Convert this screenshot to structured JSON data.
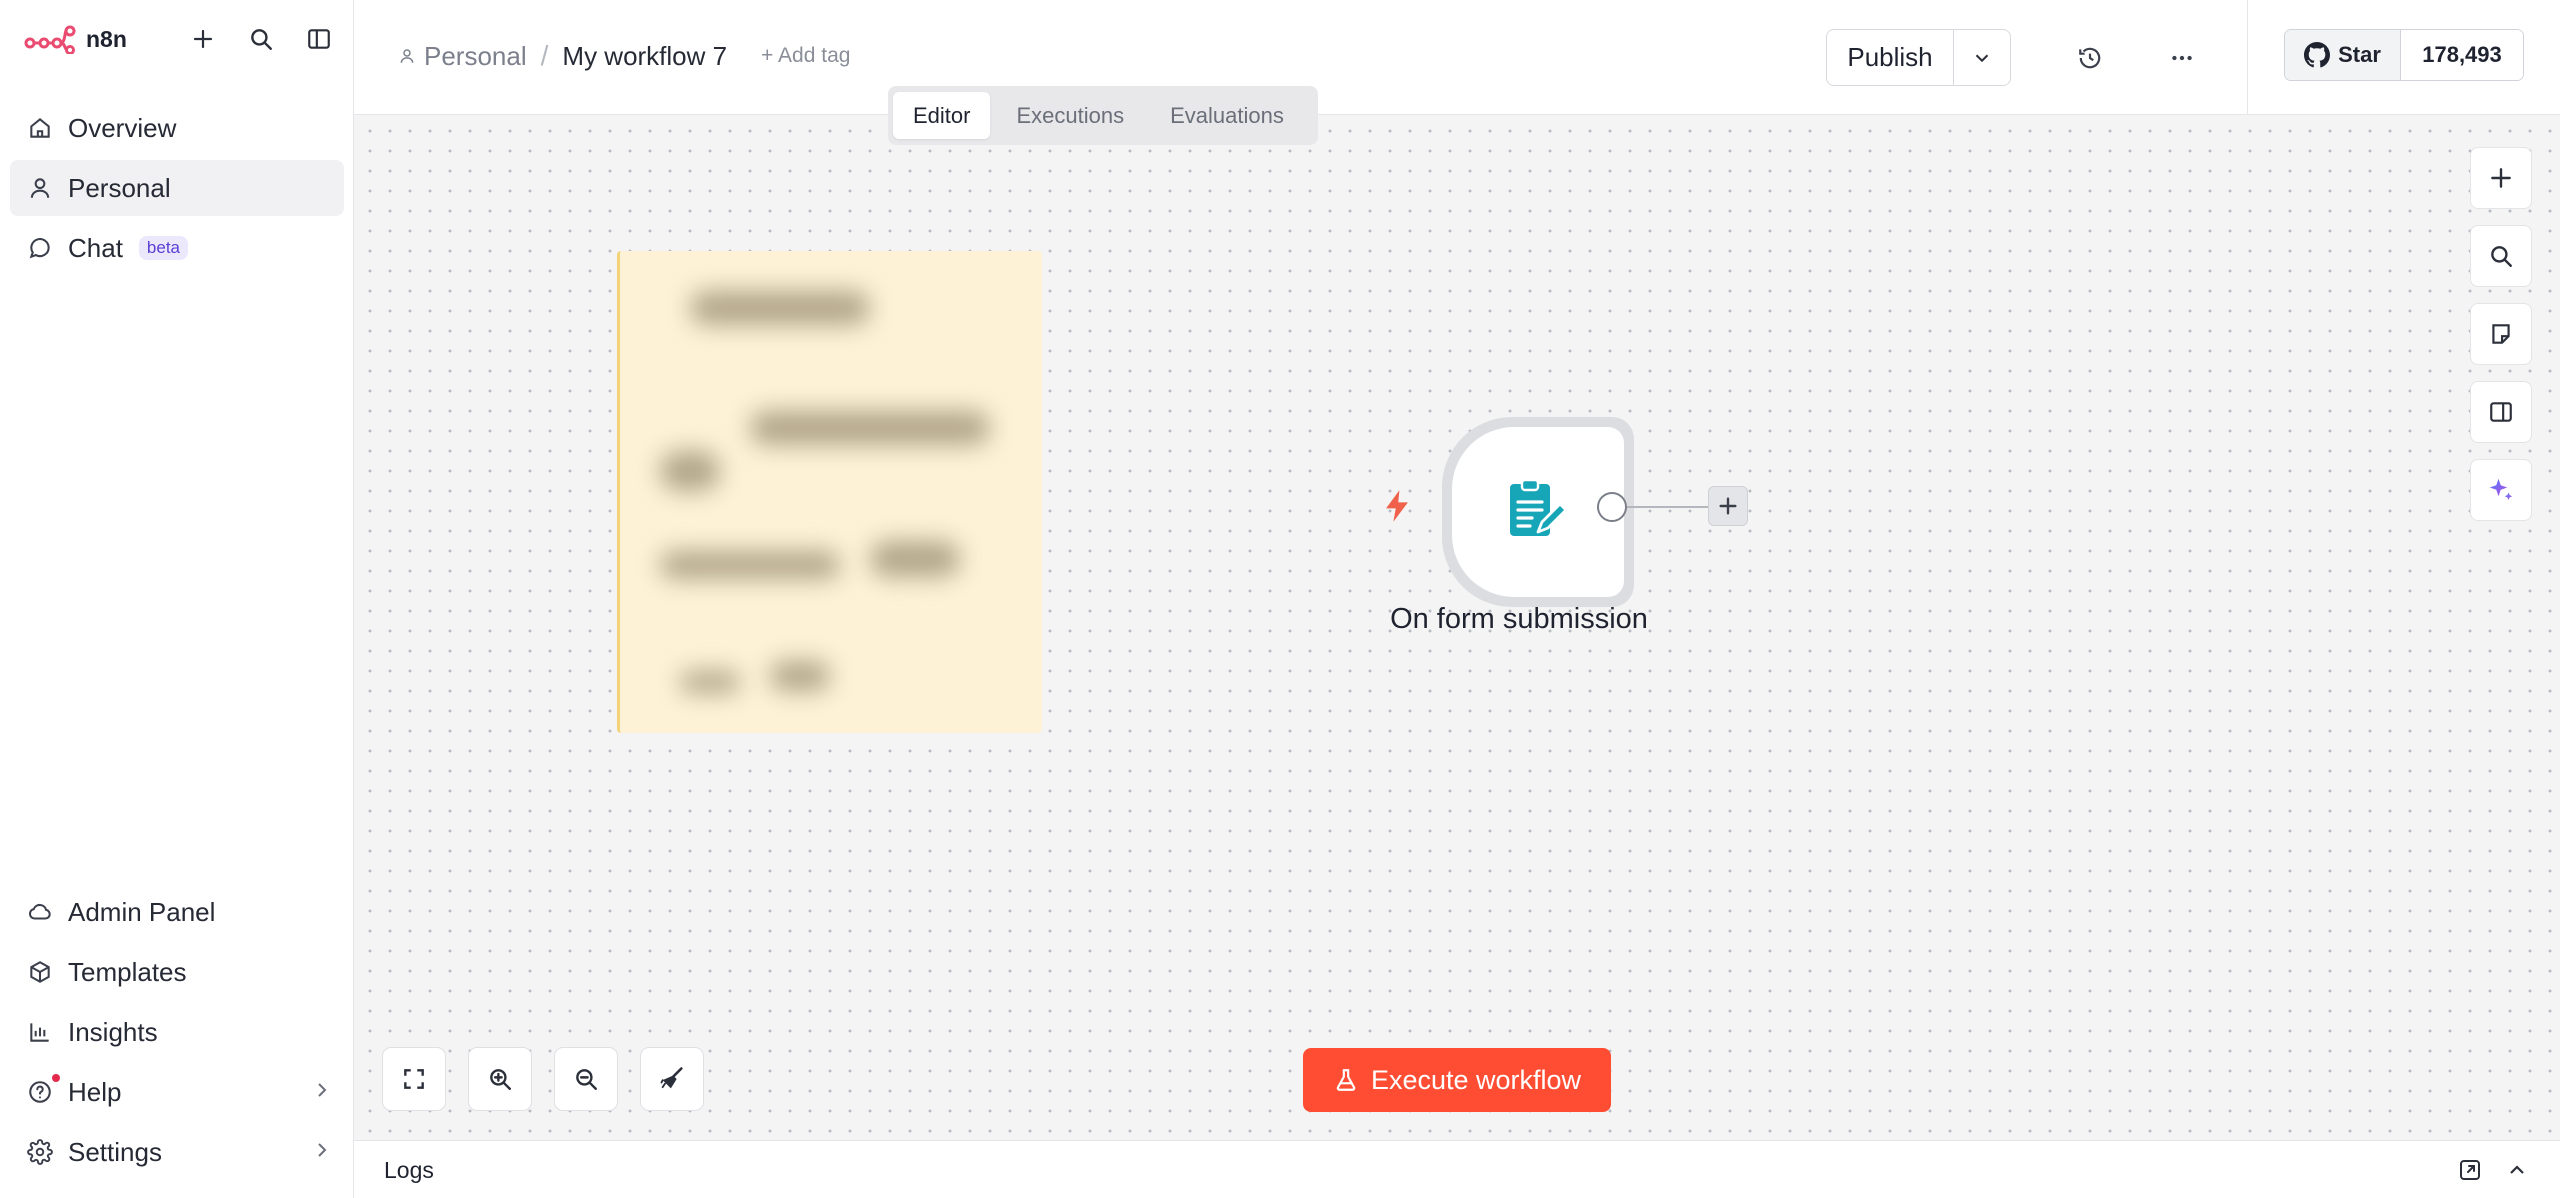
{
  "app": {
    "name": "n8n"
  },
  "sidebar": {
    "nav": [
      {
        "label": "Overview",
        "icon": "home-icon"
      },
      {
        "label": "Personal",
        "icon": "user-icon",
        "active": true
      },
      {
        "label": "Chat",
        "icon": "chat-icon",
        "badge": "beta"
      }
    ],
    "bottom": [
      {
        "label": "Admin Panel",
        "icon": "cloud-icon"
      },
      {
        "label": "Templates",
        "icon": "templates-icon"
      },
      {
        "label": "Insights",
        "icon": "insights-icon"
      },
      {
        "label": "Help",
        "icon": "help-icon"
      },
      {
        "label": "Settings",
        "icon": "gear-icon"
      }
    ]
  },
  "header": {
    "project": "Personal",
    "separator": "/",
    "workflow_name": "My workflow 7",
    "add_tag": "+ Add tag",
    "tabs": [
      {
        "label": "Editor",
        "active": true
      },
      {
        "label": "Executions"
      },
      {
        "label": "Evaluations"
      }
    ],
    "publish_label": "Publish",
    "github": {
      "star_label": "Star",
      "count": "178,493"
    }
  },
  "canvas": {
    "node": {
      "label": "On form submission",
      "icon": "form-edit-icon",
      "color": "#17a6b8"
    },
    "execute_label": "Execute workflow"
  },
  "logs": {
    "label": "Logs"
  },
  "colors": {
    "accent": "#ff4d33",
    "brand": "#ea4b71",
    "node_icon": "#17a6b8",
    "sticky": "#fdf2d6"
  }
}
